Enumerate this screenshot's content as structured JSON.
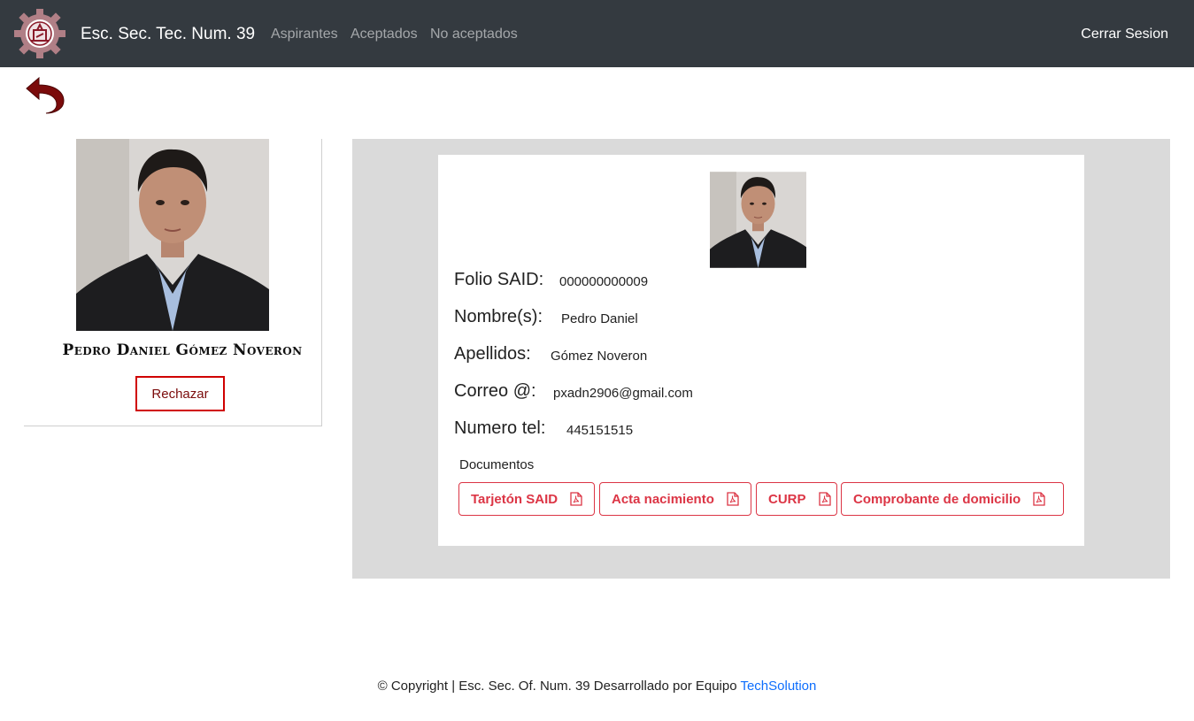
{
  "header": {
    "brand": "Esc. Sec. Tec. Num. 39",
    "nav": [
      "Aspirantes",
      "Aceptados",
      "No aceptados"
    ],
    "logout": "Cerrar Sesion",
    "logo_icon": "school-emblem-icon",
    "bg_color": "#343a40"
  },
  "back_icon": "undo-arrow-icon",
  "profile": {
    "full_name": "Pedro Daniel Gómez Noveron",
    "reject_label": "Rechazar"
  },
  "details": {
    "fields": [
      {
        "label": "Folio SAID:",
        "value": "000000000009"
      },
      {
        "label": "Nombre(s):",
        "value": "Pedro Daniel"
      },
      {
        "label": "Apellidos:",
        "value": "Gómez Noveron"
      },
      {
        "label": "Correo @:",
        "value": "pxadn2906@gmail.com"
      },
      {
        "label": "Numero tel:",
        "value": "445151515"
      }
    ],
    "documents_title": "Documentos",
    "documents": [
      "Tarjetón SAID",
      "Acta nacimiento",
      "CURP",
      "Comprobante de domicilio"
    ],
    "doc_icon": "file-pdf-icon",
    "accent_color": "#dc3545"
  },
  "footer": {
    "text": "© Copyright | Esc. Sec. Of. Num. 39 Desarrollado por Equipo ",
    "link": "TechSolution"
  }
}
